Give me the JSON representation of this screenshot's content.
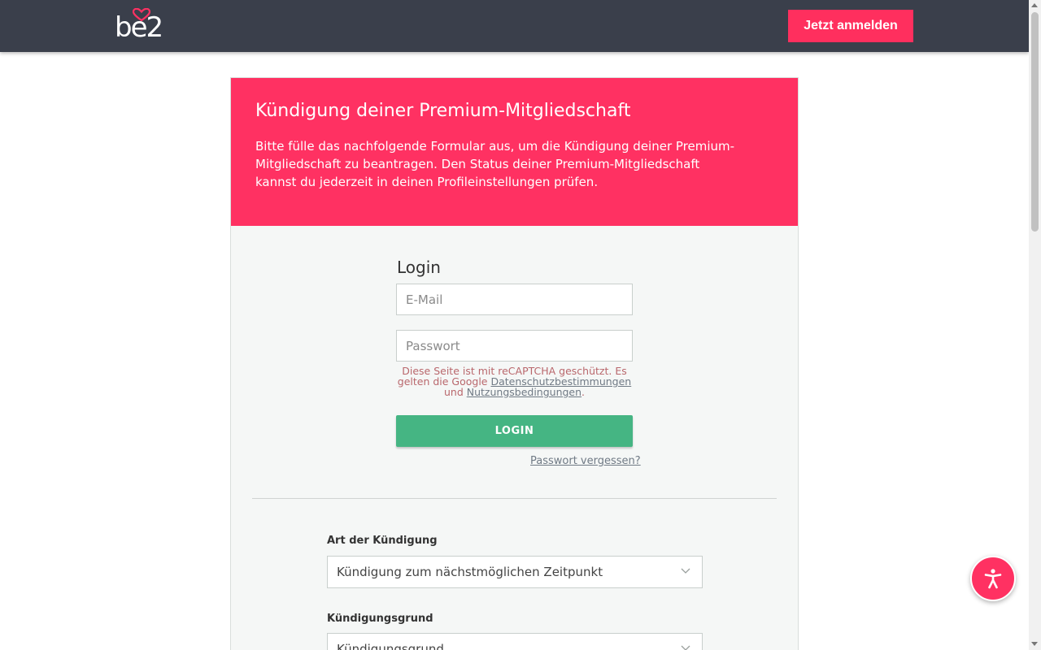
{
  "header": {
    "logo_text": "be2",
    "cta_label": "Jetzt anmelden"
  },
  "banner": {
    "title": "Kündigung deiner Premium-Mitgliedschaft",
    "text": "Bitte fülle das nachfolgende Formular aus, um die Kündigung deiner Premium-Mitgliedschaft zu beantragen. Den Status deiner Premium-Mitgliedschaft kannst du jederzeit in deinen Profileinstellungen prüfen."
  },
  "login": {
    "title": "Login",
    "email_placeholder": "E-Mail",
    "password_placeholder": "Passwort",
    "recaptcha_prefix": "Diese Seite ist mit reCAPTCHA geschützt. Es gelten die Google ",
    "privacy_link": "Datenschutzbestimmungen",
    "recaptcha_and": " und ",
    "terms_link": "Nutzungsbedingungen",
    "recaptcha_suffix": ".",
    "button_label": "LOGIN",
    "forgot_label": "Passwort vergessen?"
  },
  "cancellation": {
    "type_label": "Art der Kündigung",
    "type_value": "Kündigung zum nächstmöglichen Zeitpunkt",
    "reason_label": "Kündigungsgrund",
    "reason_value": "Kündigungsgrund"
  },
  "colors": {
    "brand": "#ff3162",
    "header_bg": "#3a3f4b",
    "login_button": "#45b583"
  },
  "icons": {
    "logo_heart": "heart-icon",
    "select_chevron": "chevron-down-icon",
    "accessibility": "accessibility-icon"
  }
}
